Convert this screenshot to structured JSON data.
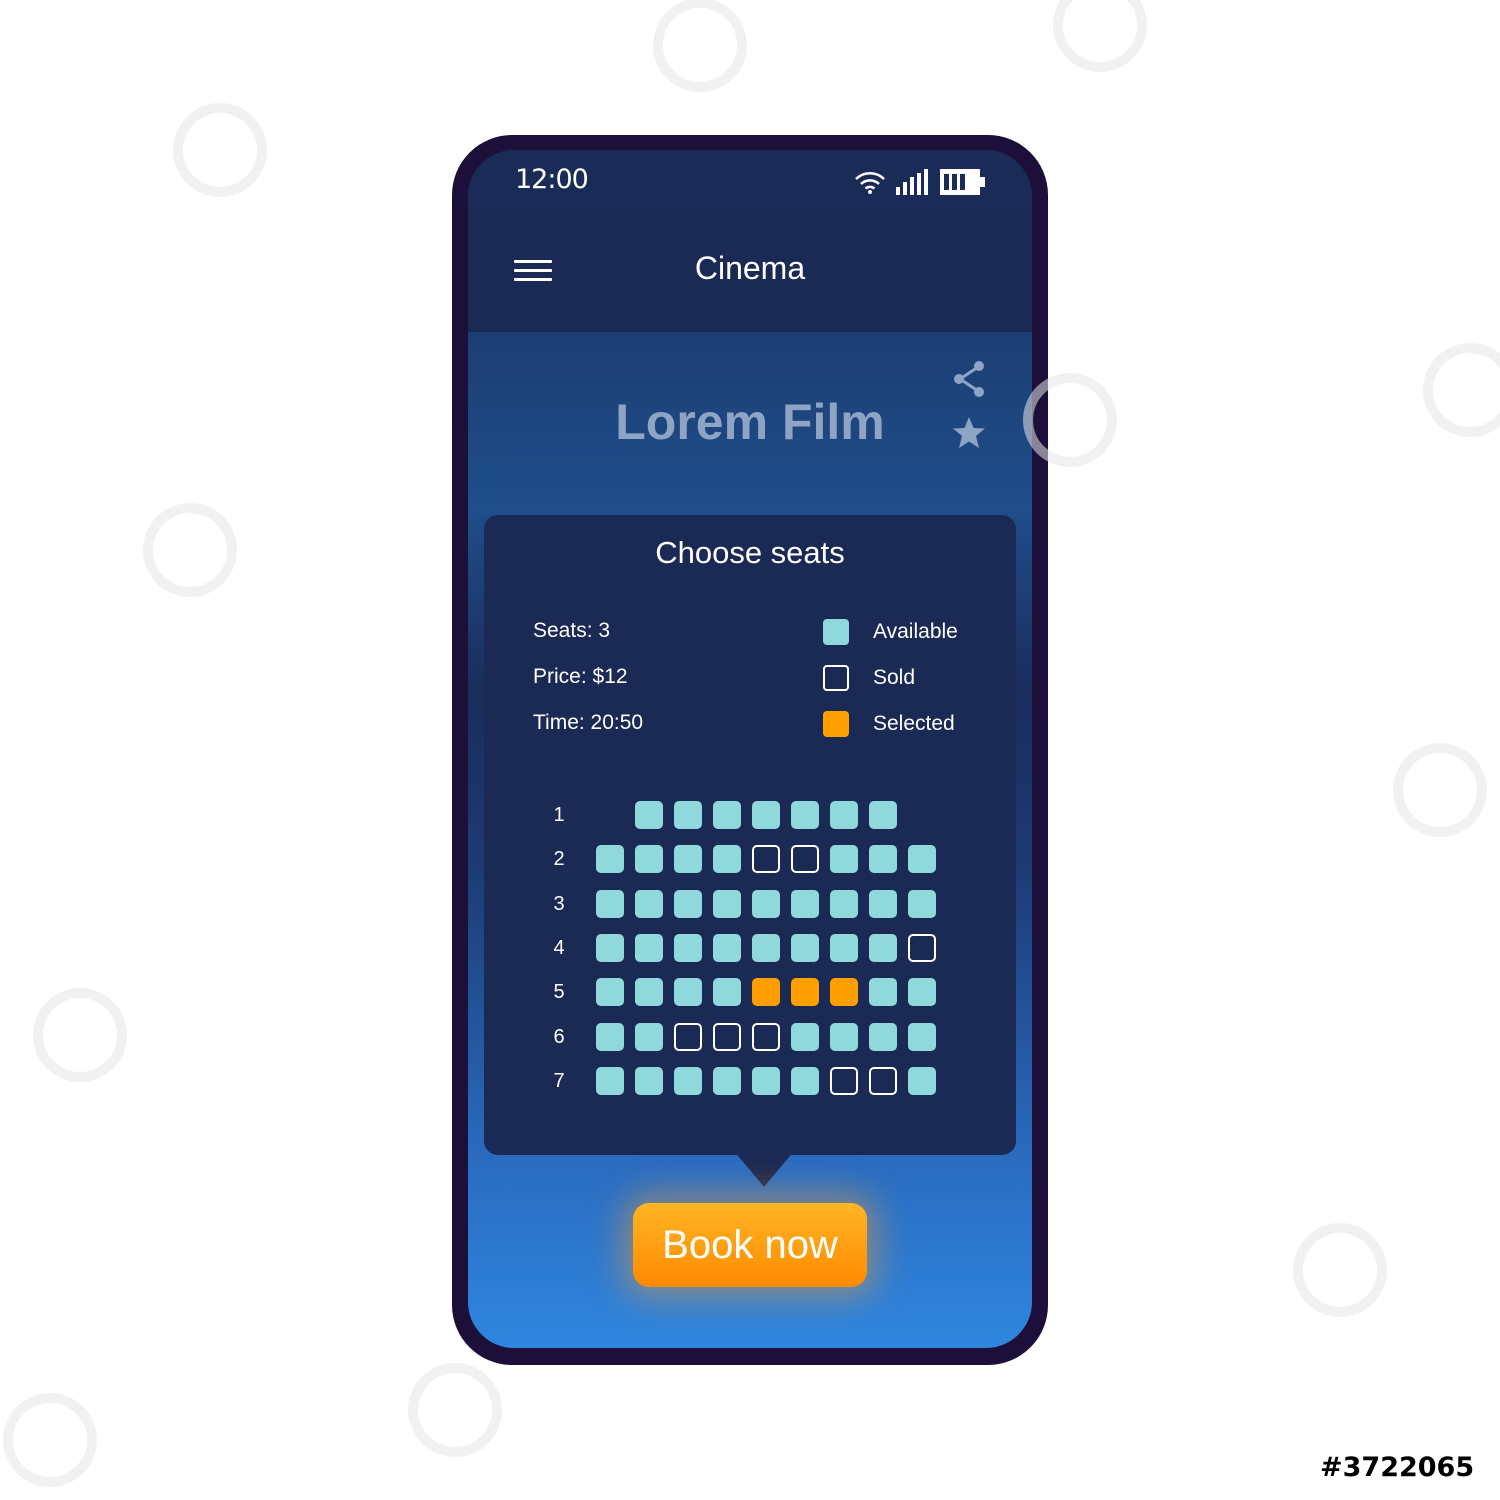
{
  "status_bar": {
    "time": "12:00"
  },
  "app_bar": {
    "title": "Cinema"
  },
  "film": {
    "title": "Lorem Film"
  },
  "seat_panel": {
    "title": "Choose seats",
    "seats_text": "Seats: 3",
    "price_text": "Price: $12",
    "time_text": "Time: 20:50",
    "legend": [
      {
        "status": "available",
        "label": "Available"
      },
      {
        "status": "sold",
        "label": "Sold"
      },
      {
        "status": "selected",
        "label": "Selected"
      }
    ],
    "rows": [
      {
        "label": "1",
        "seats": [
          "",
          "A",
          "A",
          "A",
          "A",
          "A",
          "A",
          "A",
          ""
        ]
      },
      {
        "label": "2",
        "seats": [
          "A",
          "A",
          "A",
          "A",
          "S",
          "S",
          "A",
          "A",
          "A"
        ]
      },
      {
        "label": "3",
        "seats": [
          "A",
          "A",
          "A",
          "A",
          "A",
          "A",
          "A",
          "A",
          "A"
        ]
      },
      {
        "label": "4",
        "seats": [
          "A",
          "A",
          "A",
          "A",
          "A",
          "A",
          "A",
          "A",
          "S"
        ]
      },
      {
        "label": "5",
        "seats": [
          "A",
          "A",
          "A",
          "A",
          "X",
          "X",
          "X",
          "A",
          "A"
        ]
      },
      {
        "label": "6",
        "seats": [
          "A",
          "A",
          "S",
          "S",
          "S",
          "A",
          "A",
          "A",
          "A"
        ]
      },
      {
        "label": "7",
        "seats": [
          "A",
          "A",
          "A",
          "A",
          "A",
          "A",
          "S",
          "S",
          "A"
        ]
      }
    ]
  },
  "book_button": {
    "label": "Book now"
  },
  "stock_id": "#3722065",
  "colors": {
    "available": "#8fd8dc",
    "selected": "#ff9f00",
    "sold_outline": "#ffffff",
    "panel_bg": "#1b2a55",
    "accent": "#ff9f00"
  },
  "icons": {
    "menu": "hamburger-menu-icon",
    "share": "share-icon",
    "favorite": "star-icon",
    "wifi": "wifi-icon",
    "signal": "cellular-signal-icon",
    "battery": "battery-icon"
  }
}
